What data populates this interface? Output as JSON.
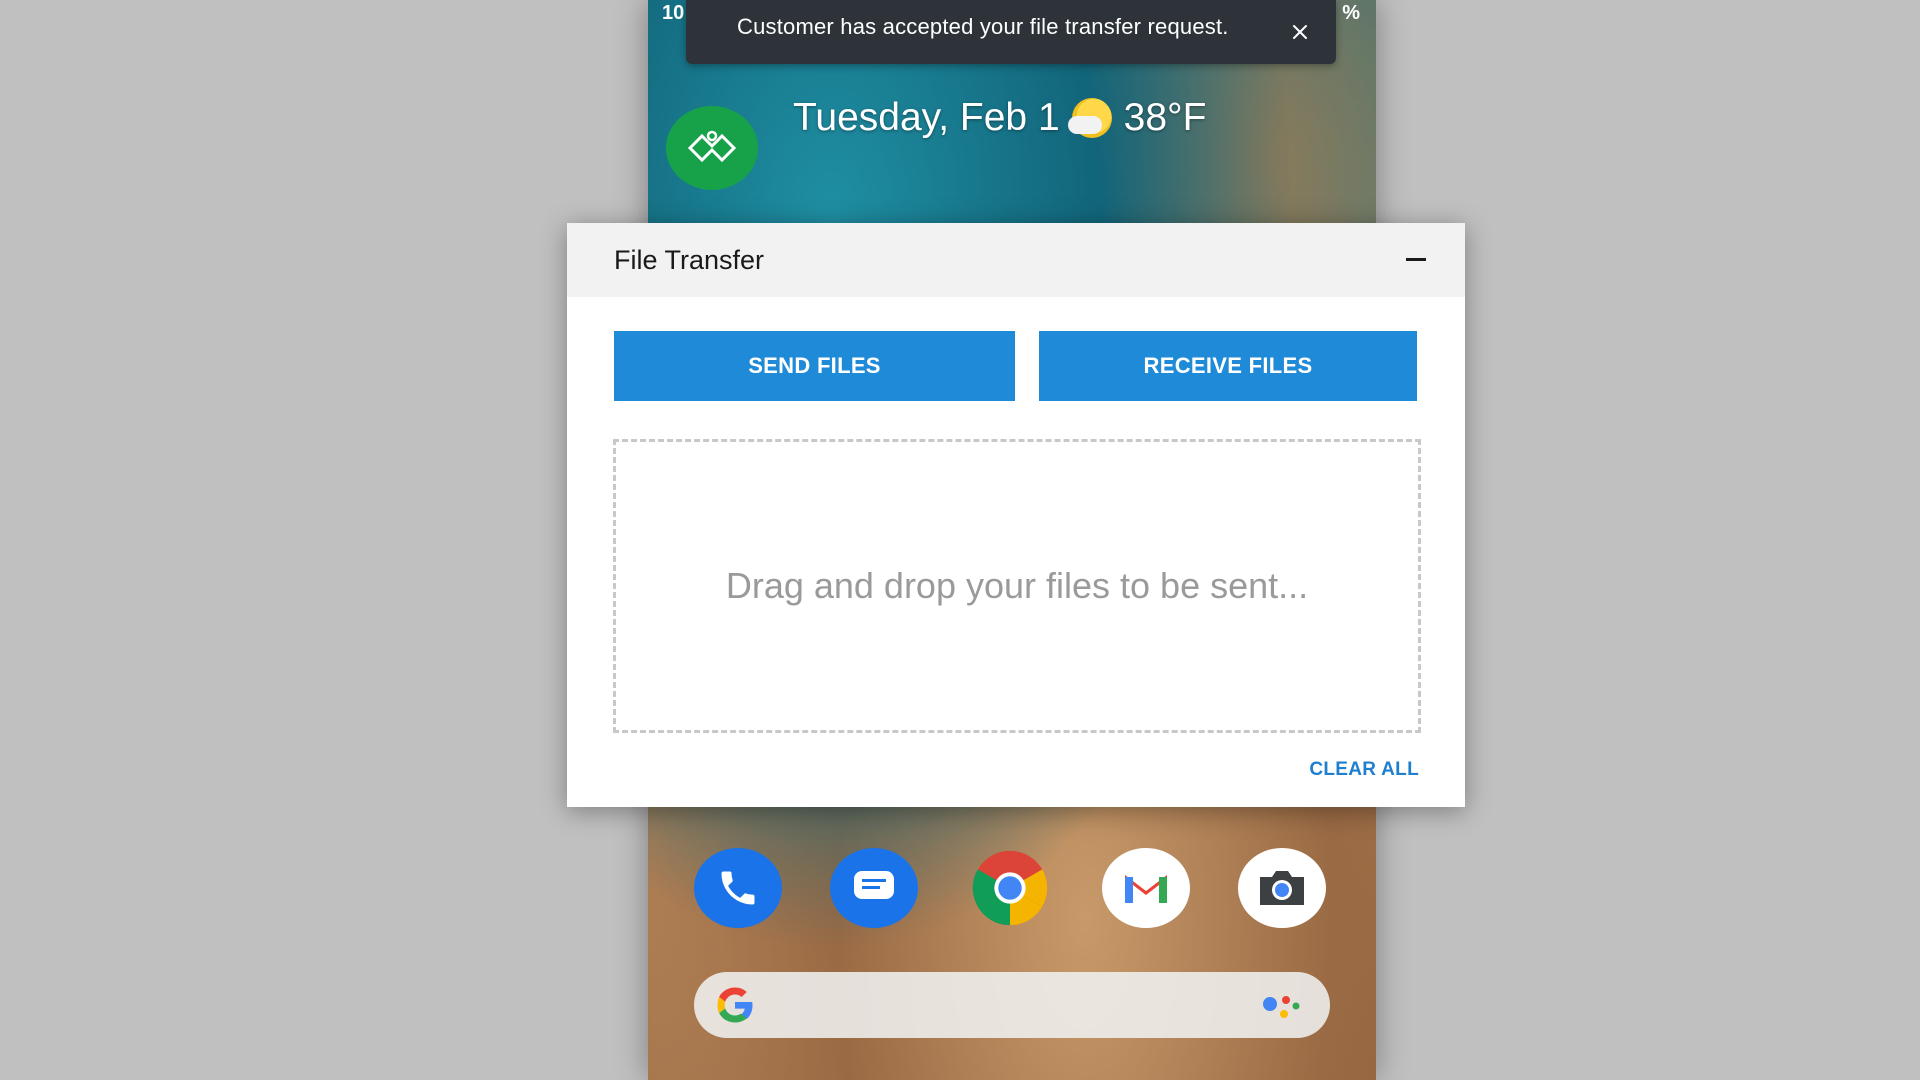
{
  "phone": {
    "status_left": "10",
    "status_right": "%",
    "weather": {
      "date": "Tuesday, Feb 1",
      "icon": "partly-cloudy-icon",
      "temperature": "38°F"
    },
    "dock_icons": [
      "phone-icon",
      "messages-icon",
      "chrome-icon",
      "gmail-icon",
      "camera-icon"
    ],
    "search": {
      "logo": "google-g-icon",
      "assistant": "google-assistant-icon"
    }
  },
  "toast": {
    "message": "Customer has accepted your file transfer request.",
    "close_icon": "close-icon"
  },
  "dialog": {
    "title": "File Transfer",
    "minimize_icon": "minimize-icon",
    "send_label": "SEND FILES",
    "receive_label": "RECEIVE FILES",
    "drop_placeholder": "Drag and drop your files to be sent...",
    "clear_all_label": "CLEAR ALL"
  },
  "colors": {
    "primary_button": "#1f8ad8",
    "link": "#1f7fcf",
    "toast_bg": "#2d3338",
    "backdrop": "#c0c0c0"
  }
}
